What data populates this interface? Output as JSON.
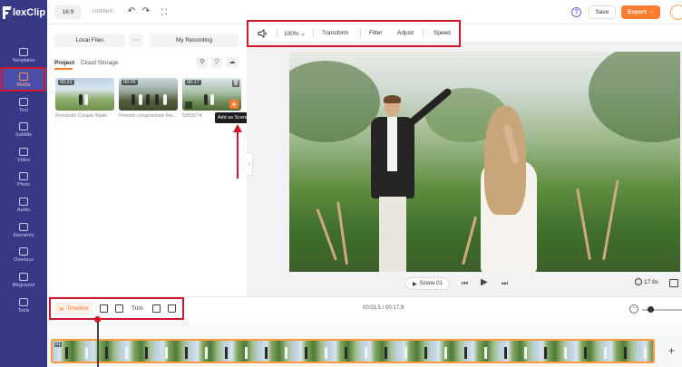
{
  "app": {
    "logo_text": "lexClip",
    "aspect_ratio": "16:9",
    "project_title": "Untitled",
    "help_label": "?",
    "save_label": "Save",
    "export_label": "Export →"
  },
  "sidebar": {
    "items": [
      {
        "label": "Templates",
        "icon": "templates-icon"
      },
      {
        "label": "Media",
        "icon": "media-icon",
        "active": true
      },
      {
        "label": "Text",
        "icon": "text-icon"
      },
      {
        "label": "Subtitle",
        "icon": "subtitle-icon"
      },
      {
        "label": "Video",
        "icon": "video-icon"
      },
      {
        "label": "Photo",
        "icon": "photo-icon"
      },
      {
        "label": "Audio",
        "icon": "audio-icon"
      },
      {
        "label": "Elements",
        "icon": "elements-icon"
      },
      {
        "label": "Overlays",
        "icon": "overlays-icon"
      },
      {
        "label": "BKground",
        "icon": "background-icon"
      },
      {
        "label": "Tools",
        "icon": "tools-icon"
      }
    ]
  },
  "media_panel": {
    "local_files_label": "Local Files",
    "more_label": "···",
    "recording_label": "My Recording",
    "tabs": [
      "Project",
      "Cloud Storage"
    ],
    "clips": [
      {
        "duration": "00:21",
        "caption": "Romantic Couple Walki"
      },
      {
        "duration": "00:05",
        "caption": "Friends congratulate the..."
      },
      {
        "duration": "00:17",
        "caption": "5903574"
      }
    ],
    "add_scene_tooltip": "Add as Scene",
    "add_button": "+"
  },
  "edit_toolbar": {
    "zoom": "100%",
    "tools": [
      "Transform",
      "Filter",
      "Adjust",
      "Speed"
    ]
  },
  "player": {
    "scene_label": "Scene 01",
    "duration": "17.9s"
  },
  "timeline": {
    "timeline_label": "Timeline",
    "trim_label": "Trim",
    "time_readout": "00:01.5 / 00:17.9",
    "track_number": "01",
    "add_label": "+"
  },
  "colors": {
    "sidebar_bg": "#363a86",
    "accent": "#ff7b2e",
    "highlight_box": "#d1162c"
  }
}
